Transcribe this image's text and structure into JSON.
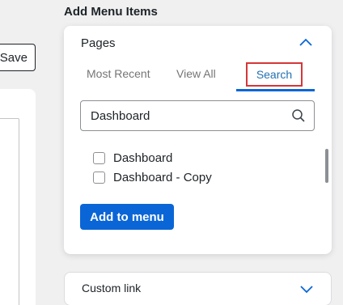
{
  "left": {
    "save_label": "Save"
  },
  "heading": "Add Menu Items",
  "pages": {
    "title": "Pages",
    "tabs": [
      {
        "label": "Most Recent"
      },
      {
        "label": "View All"
      },
      {
        "label": "Search"
      }
    ],
    "search": {
      "value": "Dashboard"
    },
    "items": [
      {
        "label": "Dashboard"
      },
      {
        "label": "Dashboard - Copy"
      }
    ],
    "add_button": "Add to menu"
  },
  "custom_link": {
    "label": "Custom link"
  },
  "colors": {
    "accent": "#0a66d6",
    "highlight_border": "#d63638",
    "tab_active": "#2271b1"
  }
}
